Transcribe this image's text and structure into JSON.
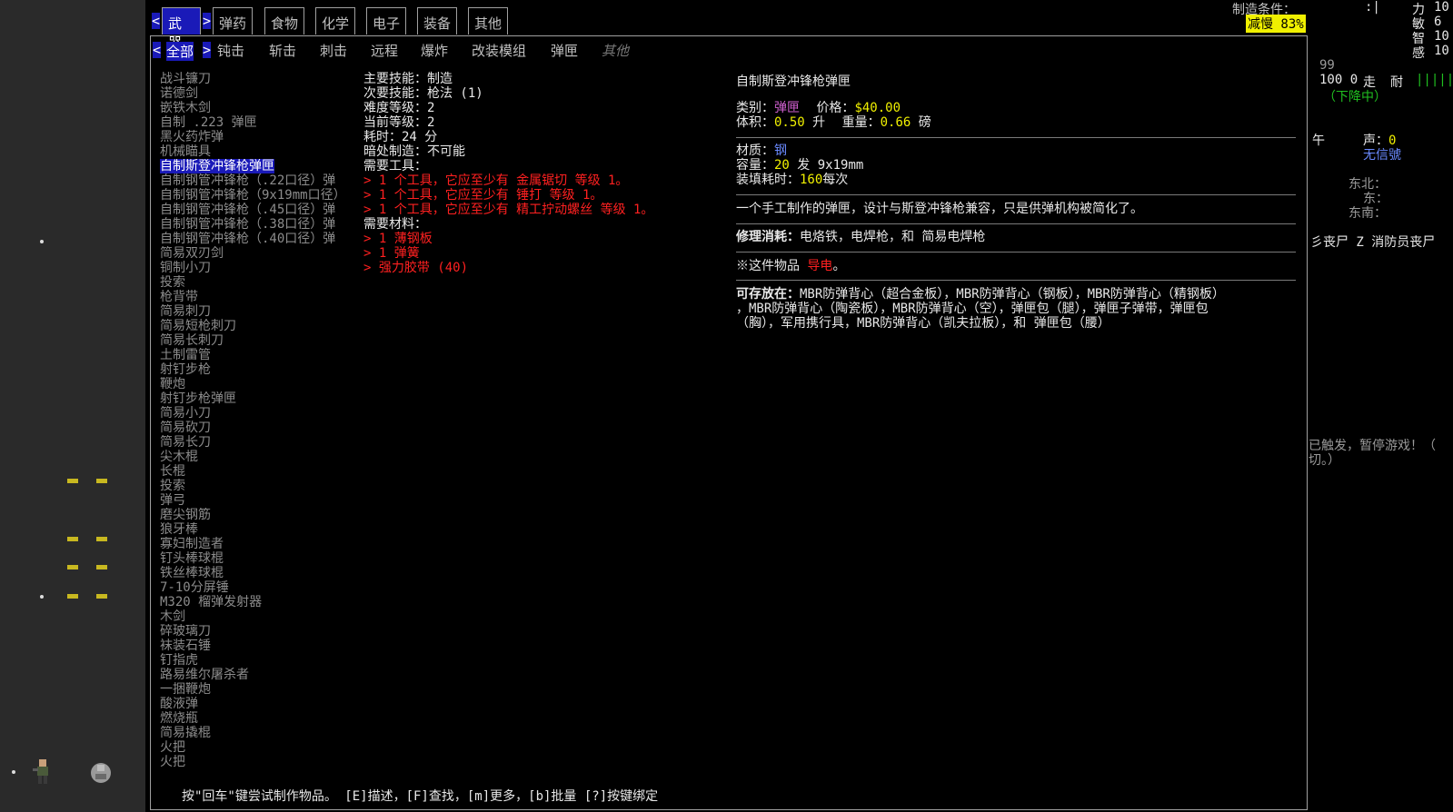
{
  "header": {
    "craft_condition_label": "制造条件：",
    "craft_condition_value": ":|",
    "speed_badge": "减慢 83%"
  },
  "stats": [
    {
      "label": "力",
      "value": "10"
    },
    {
      "label": "敏",
      "value": "6"
    },
    {
      "label": "智",
      "value": "10"
    },
    {
      "label": "感",
      "value": "10"
    }
  ],
  "tabs": [
    "武器",
    "弹药",
    "食物",
    "化学",
    "电子",
    "装备",
    "其他"
  ],
  "tab_arrows": {
    "left": "<",
    "right": ">"
  },
  "subtabs": [
    "全部",
    "钝击",
    "斩击",
    "刺击",
    "远程",
    "爆炸",
    "改装模组",
    "弹匣",
    "其他"
  ],
  "recipes": [
    "战斗镰刀",
    "诺德剑",
    "嵌铁木剑",
    "自制 .223 弹匣",
    "黑火药炸弹",
    "机械瞄具",
    "自制斯登冲锋枪弹匣",
    "自制钢管冲锋枪（.22口径）弹",
    "自制钢管冲锋枪（9x19mm口径）",
    "自制钢管冲锋枪（.45口径）弹",
    "自制钢管冲锋枪（.38口径）弹",
    "自制钢管冲锋枪（.40口径）弹",
    "简易双刃剑",
    "铜制小刀",
    "投索",
    "枪背带",
    "简易刺刀",
    "简易短枪刺刀",
    "简易长刺刀",
    "土制雷管",
    "射钉步枪",
    "鞭炮",
    "射钉步枪弹匣",
    "简易小刀",
    "简易砍刀",
    "简易长刀",
    "尖木棍",
    "长棍",
    "投索",
    "弹弓",
    "磨尖钢筋",
    "狼牙棒",
    "寡妇制造者",
    "钉头棒球棍",
    "铁丝棒球棍",
    "7-10分屏锤",
    "M320 榴弹发射器",
    "木剑",
    "碎玻璃刀",
    "袜装石锤",
    "钉指虎",
    "路易维尔屠杀者",
    "一捆鞭炮",
    "酸液弹",
    "燃烧瓶",
    "简易撬棍",
    "火把",
    "火把"
  ],
  "selected_recipe_index": 6,
  "requirements": {
    "primary_skill": "主要技能：制造",
    "secondary_skill": "次要技能：枪法 (1)",
    "difficulty": "难度等级：2",
    "current_level": "当前等级：2",
    "time": "耗时：24 分",
    "dark_craft": "暗处制造：不可能",
    "tools_header": "需要工具：",
    "tools": [
      "> 1 个工具，它应至少有 金属锯切 等级 1。",
      "> 1 个工具，它应至少有 锤打 等级 1。",
      "> 1 个工具，它应至少有 精工拧动螺丝 等级 1。"
    ],
    "materials_header": "需要材料：",
    "materials": [
      "> 1 薄钢板",
      "> 1 弹簧",
      "> 强力胶带 (40)"
    ]
  },
  "item": {
    "name": "自制斯登冲锋枪弹匣",
    "category_label": "类别：",
    "category_value": "弹匣",
    "price_label": "价格：",
    "price_value": "$40.00",
    "volume_label": "体积：",
    "volume_value": "0.50",
    "volume_unit": "升",
    "weight_label": "重量：",
    "weight_value": "0.66",
    "weight_unit": "磅",
    "material_label": "材质：",
    "material_value": "钢",
    "capacity_label": "容量：",
    "capacity_value": "20",
    "capacity_unit": "发 9x19mm",
    "reload_label": "装填耗时：",
    "reload_value": "160",
    "reload_unit": "每次",
    "description": "一个手工制作的弹匣，设计与斯登冲锋枪兼容，只是供弹机构被简化了。",
    "repair_label": "修理消耗：",
    "repair_value": "电烙铁，电焊枪，和 简易电焊枪",
    "conductive_prefix": "※这件物品",
    "conductive_value": "导电",
    "conductive_suffix": "。",
    "storage_label": "可存放在：",
    "storage_lines": [
      "MBR防弹背心（超合金板），MBR防弹背心（钢板），MBR防弹背心（精钢板）",
      "，MBR防弹背心（陶瓷板），MBR防弹背心（空），弹匣包（腿），弹匣子弹带，弹匣包",
      "（胸），军用携行具，MBR防弹背心（凯夫拉板），和 弹匣包（腰）"
    ]
  },
  "footer": "按\"回车\"键尝试制作物品。   [E]描述，[F]查找，[m]更多，[b]批量 [?]按键绑定",
  "sidebar": {
    "v99": "99",
    "hp_line": "100 0",
    "walk": "走",
    "endurance": "耐",
    "bars": "|||||",
    "descending": "（下降中）",
    "noon": "午",
    "sound_label": "声：",
    "sound_value": "0",
    "no_sign": "无信號",
    "northeast": "东北：",
    "east": "东：",
    "southeast": "东南：",
    "zombie_line": "彡丧尸  Z 消防员丧尸",
    "alert_line1": "已触发，暂停游戏！（",
    "alert_line2": "切。）"
  }
}
